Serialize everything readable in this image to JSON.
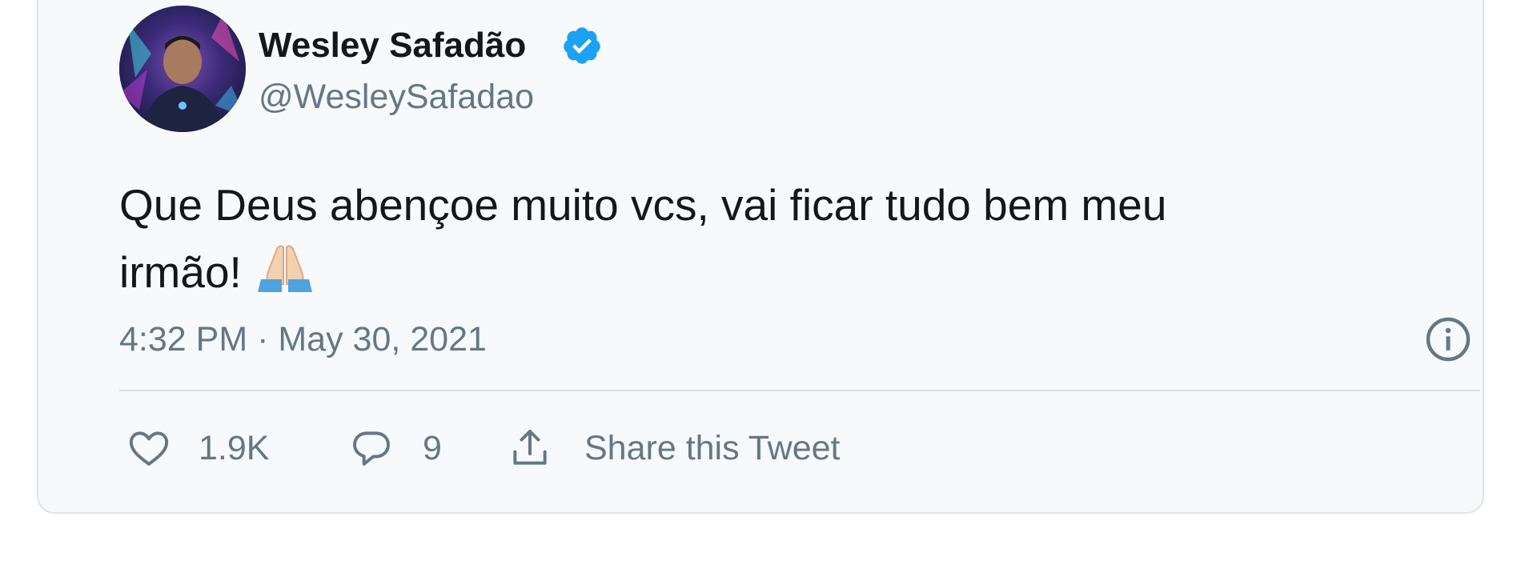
{
  "tweet": {
    "display_name": "Wesley Safadão",
    "handle": "@WesleySafadao",
    "verified": true,
    "text_lines": [
      "Que Deus abençoe muito vcs, vai ficar tudo bem meu",
      "irmão!"
    ],
    "emoji": "folded-hands",
    "timestamp": "4:32 PM · May 30, 2021"
  },
  "actions": {
    "like_count": "1.9K",
    "reply_count": "9",
    "share_label": "Share this Tweet"
  },
  "icons": {
    "verified": "verified-badge-icon",
    "info": "info-icon",
    "like": "heart-icon",
    "reply": "reply-bubble-icon",
    "share": "share-icon"
  },
  "colors": {
    "card_bg": "#f7f9fa",
    "verified_blue": "#1da1f2",
    "text": "#14171a",
    "muted": "#657786"
  }
}
